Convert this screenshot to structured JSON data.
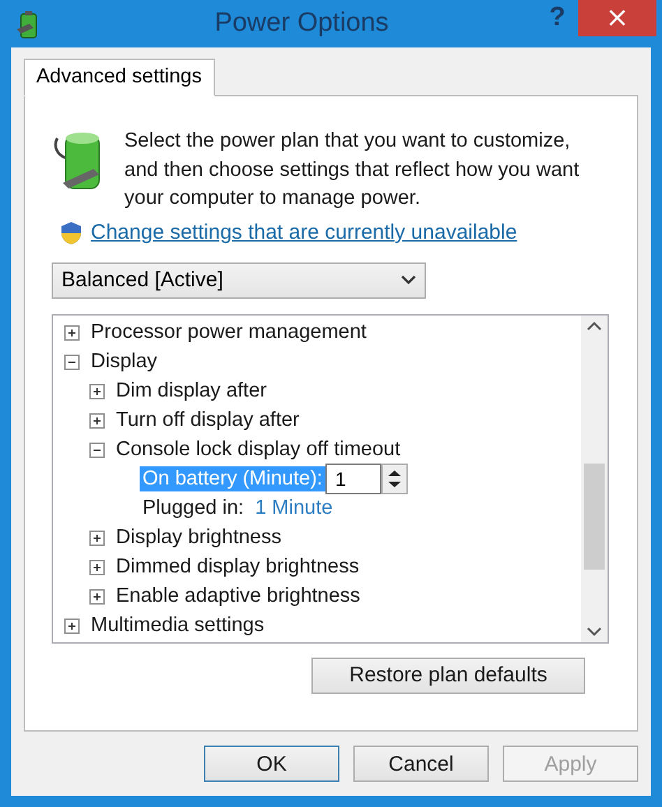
{
  "window": {
    "title": "Power Options",
    "help": "?",
    "close": "×"
  },
  "tabs": [
    {
      "label": "Advanced settings",
      "selected": true
    }
  ],
  "intro": "Select the power plan that you want to customize, and then choose settings that reflect how you want your computer to manage power.",
  "link": "Change settings that are currently unavailable",
  "plan": {
    "value": "Balanced [Active]"
  },
  "tree": [
    {
      "kind": "group",
      "label": "Processor power management",
      "expanded": false
    },
    {
      "kind": "group",
      "label": "Display",
      "expanded": true,
      "children": [
        {
          "kind": "group",
          "label": "Dim display after",
          "expanded": false
        },
        {
          "kind": "group",
          "label": "Turn off display after",
          "expanded": false
        },
        {
          "kind": "group",
          "label": "Console lock display off timeout",
          "expanded": true,
          "children": [
            {
              "kind": "spin",
              "label": "On battery (Minute):",
              "value": "1",
              "selected": true
            },
            {
              "kind": "text",
              "label": "Plugged in:",
              "value": "1 Minute",
              "selected": false
            }
          ]
        },
        {
          "kind": "group",
          "label": "Display brightness",
          "expanded": false
        },
        {
          "kind": "group",
          "label": "Dimmed display brightness",
          "expanded": false
        },
        {
          "kind": "group",
          "label": "Enable adaptive brightness",
          "expanded": false
        }
      ]
    },
    {
      "kind": "group",
      "label": "Multimedia settings",
      "expanded": false
    }
  ],
  "restore": "Restore plan defaults",
  "buttons": [
    {
      "label": "OK",
      "kind": "default",
      "disabled": false
    },
    {
      "label": "Cancel",
      "kind": "normal",
      "disabled": false
    },
    {
      "label": "Apply",
      "kind": "normal",
      "disabled": true
    }
  ]
}
